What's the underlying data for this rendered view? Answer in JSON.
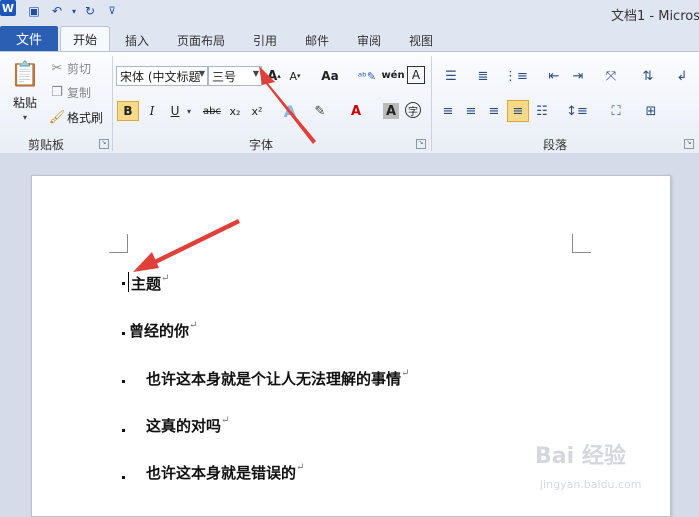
{
  "title_bar": {
    "app_icon": "W",
    "doc_title": "文档1 - Micros"
  },
  "tabs": {
    "file": "文件",
    "home": "开始",
    "insert": "插入",
    "page_layout": "页面布局",
    "references": "引用",
    "mailings": "邮件",
    "review": "审阅",
    "view": "视图"
  },
  "clipboard": {
    "paste": "粘贴",
    "cut": "剪切",
    "copy": "复制",
    "format_painter": "格式刷",
    "group_label": "剪贴板"
  },
  "font": {
    "name": "宋体 (中文标题",
    "size": "三号",
    "group_label": "字体",
    "bold": "B",
    "italic": "I",
    "underline": "U",
    "strike": "abc",
    "sub": "x₂",
    "sup": "x²",
    "aa": "Aa",
    "color_a": "A",
    "wen": "wén",
    "zi": "字"
  },
  "paragraph": {
    "group_label": "段落"
  },
  "document": {
    "lines": [
      "主题",
      "曾经的你",
      "也许这本身就是个让人无法理解的事情",
      "这真的对吗",
      "也许这本身就是错误的"
    ]
  },
  "watermark": {
    "main": "Bai 经验",
    "sub": "jingyan.baidu.com"
  },
  "colors": {
    "file_tab": "#2b5fb4",
    "annotation_arrow": "#e0403a",
    "highlight": "#f7d98a"
  }
}
